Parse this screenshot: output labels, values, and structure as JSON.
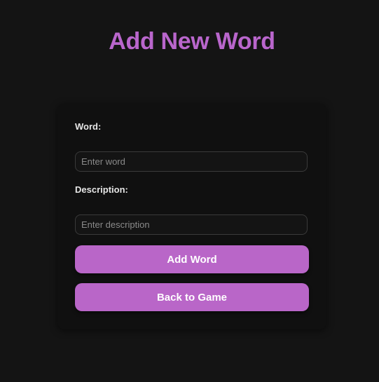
{
  "page": {
    "title": "Add New Word"
  },
  "form": {
    "word_label": "Word:",
    "word_placeholder": "Enter word",
    "word_value": "",
    "description_label": "Description:",
    "description_placeholder": "Enter description",
    "description_value": "",
    "add_button_label": "Add Word",
    "back_button_label": "Back to Game"
  },
  "colors": {
    "accent": "#b966c8",
    "background": "#141414",
    "card": "#101010"
  }
}
